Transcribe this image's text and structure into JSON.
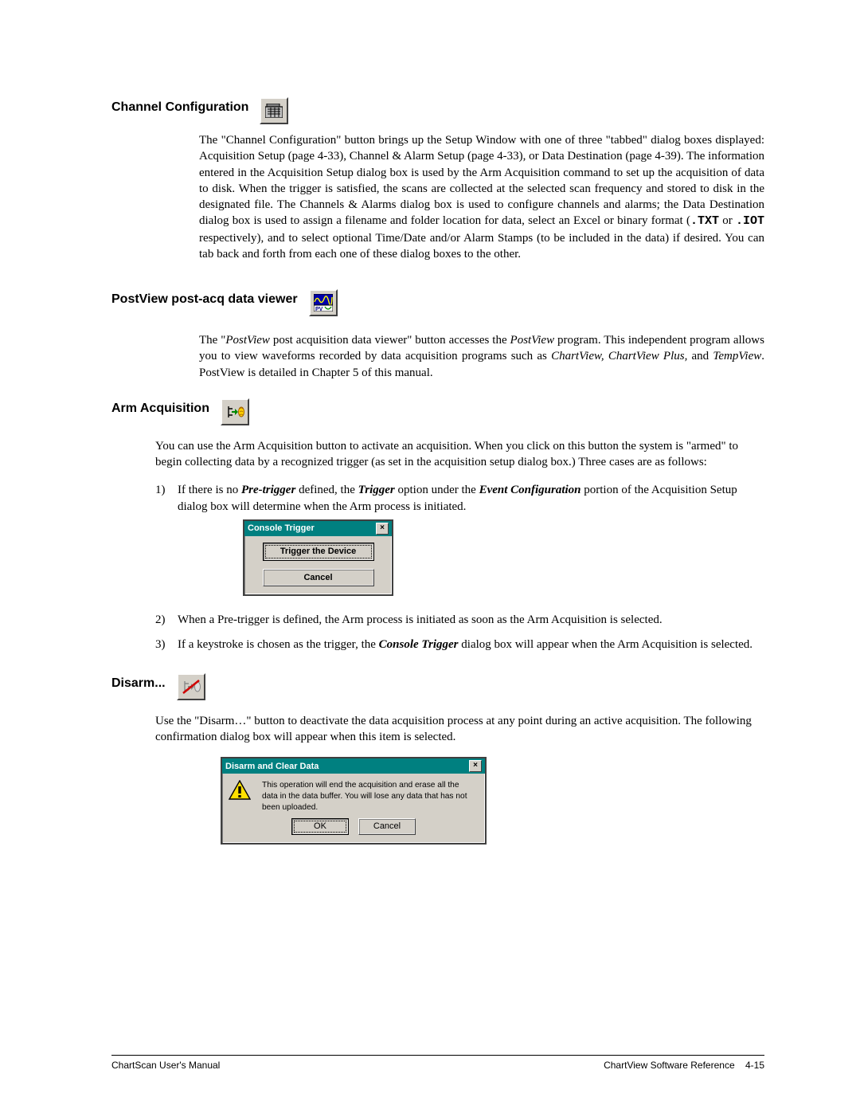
{
  "sections": {
    "channel_config": {
      "heading": "Channel Configuration",
      "p1a": "The \"Channel Configuration\" button brings up the Setup Window with one of three \"tabbed\" dialog boxes displayed:  Acquisition Setup (page 4-33), Channel & Alarm Setup (page 4-33), or Data Destination (page 4-39).  The information entered in the Acquisition Setup dialog box is used by the Arm Acquisition command to set up the acquisition of data to disk.  When the trigger is satisfied, the scans are collected at the selected scan frequency and stored to disk in the designated file. The Channels & Alarms dialog box  is used to configure channels and alarms;  the Data Destination dialog box is used to assign a filename and folder location for data, select an Excel or binary format (",
      "code1": ".TXT",
      "p1b": " or ",
      "code2": ".IOT",
      "p1c": " respectively), and to select optional Time/Date and/or Alarm Stamps (to be included in the data) if desired.   You can tab back and forth from each one of these dialog boxes to the other."
    },
    "postview": {
      "heading": "PostView post-acq data viewer",
      "p_a": "The \"",
      "p_it1": "PostView",
      "p_b": " post acquisition data viewer\" button accesses the ",
      "p_it2": "PostView",
      "p_c": " program.  This independent program allows you to view waveforms recorded by data acquisition programs such as ",
      "p_it3": "ChartView, ChartView Plus,",
      "p_d": " and ",
      "p_it4": "TempView",
      "p_e": ".  PostView is detailed in Chapter 5 of this manual."
    },
    "arm": {
      "heading": "Arm Acquisition",
      "intro": "You can use the Arm Acquisition button to activate an acquisition.  When you click on this button the system is \"armed\" to begin collecting data by a recognized trigger (as set in the acquisition setup dialog box.) Three cases are as follows:",
      "li1_a": "If there is no ",
      "li1_b1": "Pre-trigger",
      "li1_c": " defined, the ",
      "li1_b2": "Trigger",
      "li1_d": " option under the ",
      "li1_b3": "Event Configuration",
      "li1_e": " portion of  the Acquisition Setup dialog box will determine when the Arm process is initiated.",
      "li2": "When a Pre-trigger is defined, the Arm process is initiated as soon as the Arm Acquisition is selected.",
      "li3_a": "If a keystroke is chosen as the trigger, the ",
      "li3_b": "Console Trigger",
      "li3_c": " dialog box will appear when the Arm Acquisition is selected.",
      "n1": "1)",
      "n2": "2)",
      "n3": "3)"
    },
    "disarm": {
      "heading": "Disarm...",
      "p": "Use the \"Disarm…\" button to deactivate the data acquisition process at any point during an active acquisition. The following confirmation dialog box will appear when this item is selected."
    }
  },
  "dialogs": {
    "console_trigger": {
      "title": "Console Trigger",
      "btn_trigger": "Trigger the Device",
      "btn_cancel": "Cancel"
    },
    "disarm": {
      "title": "Disarm and Clear Data",
      "message": "This operation will end the acquisition and erase all the data in the data buffer.  You will lose any data that has not been uploaded.",
      "btn_ok": "OK",
      "btn_cancel": "Cancel"
    }
  },
  "footer": {
    "left": "ChartScan User's Manual",
    "right_a": "ChartView Software Reference",
    "right_b": "4-15"
  }
}
